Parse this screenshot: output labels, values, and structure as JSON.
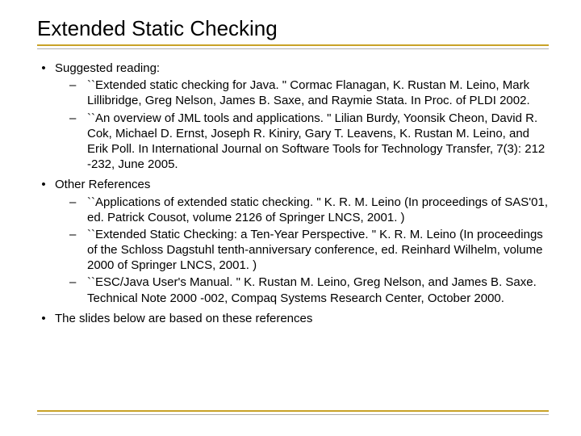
{
  "title": "Extended Static Checking",
  "bullets": [
    {
      "text": "Suggested reading:",
      "children": [
        "``Extended static checking for Java. \" Cormac Flanagan, K. Rustan M. Leino, Mark Lillibridge, Greg Nelson, James B. Saxe, and Raymie Stata. In Proc. of PLDI 2002.",
        "``An overview of JML tools and applications. \" Lilian Burdy, Yoonsik Cheon, David R. Cok, Michael D. Ernst, Joseph R. Kiniry, Gary T. Leavens, K. Rustan M. Leino, and Erik Poll. In International Journal on Software Tools for Technology Transfer, 7(3): 212 -232, June 2005."
      ]
    },
    {
      "text": "Other References",
      "children": [
        "``Applications of extended static checking. \" K. R. M. Leino (In proceedings of SAS'01, ed. Patrick Cousot, volume 2126 of Springer LNCS, 2001. )",
        "``Extended Static Checking: a Ten-Year Perspective. \" K. R. M. Leino (In proceedings of the Schloss Dagstuhl tenth-anniversary conference, ed. Reinhard Wilhelm, volume 2000 of Springer LNCS, 2001. )",
        "``ESC/Java User's Manual. \"  K. Rustan M. Leino, Greg Nelson, and James B. Saxe. Technical Note 2000 -002, Compaq Systems Research Center, October 2000."
      ]
    },
    {
      "text": "The slides below are based on these references",
      "children": []
    }
  ]
}
